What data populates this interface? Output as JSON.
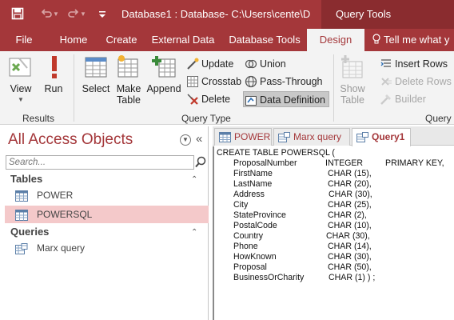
{
  "titlebar": {
    "title": "Database1 : Database- C:\\Users\\cente\\D",
    "context_tab": "Query Tools",
    "save_icon": "save-icon",
    "undo_icon": "undo-icon",
    "redo_icon": "redo-icon",
    "customize_icon": "customize-quick-access-icon"
  },
  "ribbon_tabs": {
    "file": "File",
    "home": "Home",
    "create": "Create",
    "external_data": "External Data",
    "database_tools": "Database Tools",
    "design": "Design",
    "tell_me": "Tell me what y"
  },
  "ribbon": {
    "results": {
      "view": "View",
      "run": "Run",
      "label": "Results"
    },
    "query_type": {
      "select": "Select",
      "make_table_1": "Make",
      "make_table_2": "Table",
      "append": "Append",
      "update": "Update",
      "crosstab": "Crosstab",
      "delete": "Delete",
      "union": "Union",
      "pass_through": "Pass-Through",
      "data_definition": "Data Definition",
      "label": "Query Type"
    },
    "query_setup": {
      "show_table_1": "Show",
      "show_table_2": "Table",
      "insert_rows": "Insert Rows",
      "delete_rows": "Delete Rows",
      "builder": "Builder",
      "label": "Query S"
    }
  },
  "nav": {
    "title": "All Access Objects",
    "search_placeholder": "Search...",
    "tables_header": "Tables",
    "queries_header": "Queries",
    "tables": [
      "POWER",
      "POWERSQL"
    ],
    "queries": [
      "Marx query"
    ]
  },
  "doc_tabs": [
    "POWER",
    "Marx query",
    "Query1"
  ],
  "sql": {
    "header": "CREATE TABLE POWERSQL (",
    "rows": [
      {
        "name": "ProposalNumber",
        "type": "INTEGER",
        "extra": "PRIMARY KEY,"
      },
      {
        "name": "FirstName",
        "type": "CHAR (15),",
        "extra": ""
      },
      {
        "name": "LastName",
        "type": "CHAR (20),",
        "extra": ""
      },
      {
        "name": "Address",
        "type": "CHAR (30),",
        "extra": ""
      },
      {
        "name": "City",
        "type": "CHAR (25),",
        "extra": ""
      },
      {
        "name": "StateProvince",
        "type": "CHAR (2),",
        "extra": ""
      },
      {
        "name": "PostalCode",
        "type": "CHAR (10),",
        "extra": ""
      },
      {
        "name": "Country",
        "type": "CHAR (30),",
        "extra": ""
      },
      {
        "name": "Phone",
        "type": "CHAR (14),",
        "extra": ""
      },
      {
        "name": "HowKnown",
        "type": "CHAR (30),",
        "extra": ""
      },
      {
        "name": "Proposal",
        "type": "CHAR (50),",
        "extra": ""
      },
      {
        "name": "BusinessOrCharity",
        "type": "CHAR (1) ) ;",
        "extra": ""
      }
    ]
  },
  "colors": {
    "brand": "#a4373a",
    "brand_dark": "#8a2c2f",
    "ribbon_bg": "#f3f3f3",
    "selected_item": "#f4c9ca"
  }
}
